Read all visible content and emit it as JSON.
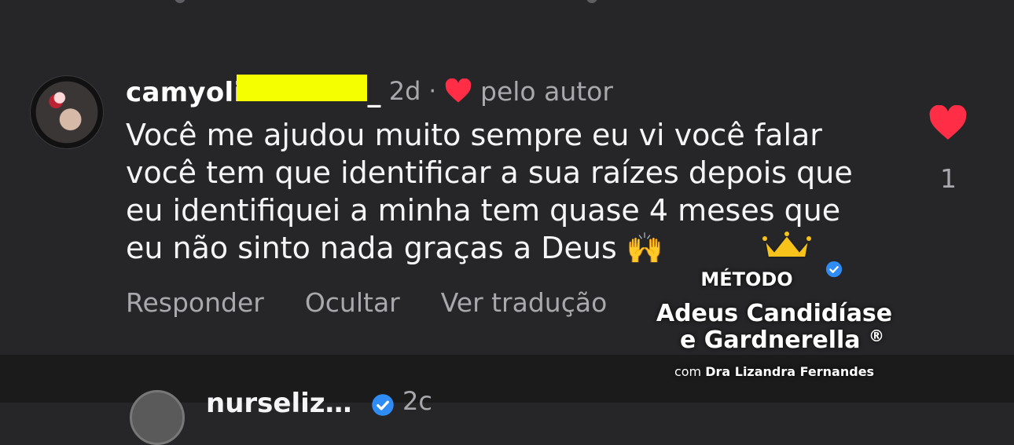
{
  "comment": {
    "username": "camyoli",
    "username_suffix": "_",
    "time": "2d",
    "separator": "·",
    "liked_by_author_label": "pelo autor",
    "text": "Você me ajudou muito sempre eu vi você falar\nvocê tem que identificar a sua raízes depois que\neu identifiquei a minha tem quase 4 meses que\neu não sinto nada graças a Deus 🙌",
    "actions": {
      "reply": "Responder",
      "hide": "Ocultar",
      "translate": "Ver tradução"
    },
    "like_count": "1",
    "heart_color": "#ff2d46"
  },
  "next_comment": {
    "username": "nurseliz…",
    "time": "2c"
  },
  "watermark": {
    "method_label": "MÉTODO",
    "title_line1": "Adeus Candidíase",
    "title_line2": "e Gardnerella",
    "registered_mark": "®",
    "credit_prefix": "com",
    "credit_name": "Dra Lizandra Fernandes"
  }
}
